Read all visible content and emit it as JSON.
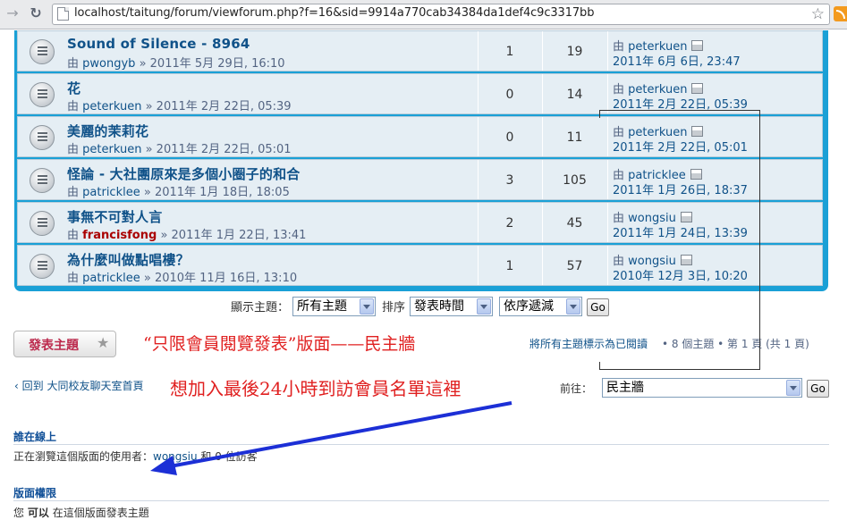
{
  "browser": {
    "url": "localhost/taitung/forum/viewforum.php?f=16&sid=9914a770cab34384da1def4c9c3317bb"
  },
  "topics": [
    {
      "title": "Sound of Silence - 8964",
      "by": "由",
      "author": "pwongyb",
      "author_style": "normal",
      "date": "» 2011年 5月 29日, 16:10",
      "replies": "1",
      "views": "19",
      "last_by": "由",
      "last_author": "peterkuen",
      "last_date": "2011年 6月 6日, 23:47"
    },
    {
      "title": "花",
      "by": "由",
      "author": "peterkuen",
      "author_style": "normal",
      "date": "» 2011年 2月 22日, 05:39",
      "replies": "0",
      "views": "14",
      "last_by": "由",
      "last_author": "peterkuen",
      "last_date": "2011年 2月 22日, 05:39"
    },
    {
      "title": "美麗的茉莉花",
      "by": "由",
      "author": "peterkuen",
      "author_style": "normal",
      "date": "» 2011年 2月 22日, 05:01",
      "replies": "0",
      "views": "11",
      "last_by": "由",
      "last_author": "peterkuen",
      "last_date": "2011年 2月 22日, 05:01"
    },
    {
      "title": "怪論 - 大社團原來是多個小圈子的和合",
      "by": "由",
      "author": "patricklee",
      "author_style": "normal",
      "date": "» 2011年 1月 18日, 18:05",
      "replies": "3",
      "views": "105",
      "last_by": "由",
      "last_author": "patricklee",
      "last_date": "2011年 1月 26日, 18:37"
    },
    {
      "title": "事無不可對人言",
      "by": "由",
      "author": "francisfong",
      "author_style": "red",
      "date": "» 2011年 1月 22日, 13:41",
      "replies": "2",
      "views": "45",
      "last_by": "由",
      "last_author": "wongsiu",
      "last_date": "2011年 1月 24日, 13:39"
    },
    {
      "title": "為什麼叫做點唱樓？",
      "by": "由",
      "author": "patricklee",
      "author_style": "normal",
      "date": "» 2010年 11月 16日, 13:10",
      "replies": "1",
      "views": "57",
      "last_by": "由",
      "last_author": "wongsiu",
      "last_date": "2010年 12月 3日, 10:20"
    }
  ],
  "filter": {
    "display_label": "顯示主題：",
    "display_value": "所有主題",
    "sort_label": "排序",
    "sort_value": "發表時間",
    "order_value": "依序遞減",
    "go_label": "Go"
  },
  "post_button": {
    "label": "發表主題",
    "icon": "star-icon"
  },
  "annotations": {
    "line1": "“只限會員閱覽發表”版面——民主牆",
    "line2": "想加入最後24小時到訪會員名單這裡",
    "color": "#e02020"
  },
  "pagination": {
    "mark_read": "將所有主題標示為已閱讀",
    "info": "• 8 個主題 • 第 1 頁 (共 1 頁)"
  },
  "back_link": {
    "arrow": "‹",
    "label": "回到 大同校友聊天室首頁"
  },
  "jump": {
    "label": "前往：",
    "value": "民主牆",
    "go_label": "Go"
  },
  "online": {
    "heading": "誰在線上",
    "text_prefix": "正在瀏覽這個版面的使用者：",
    "user": "wongsiu",
    "text_suffix": " 和 0 位訪客"
  },
  "permissions": {
    "heading": "版面權限",
    "prefix": "您",
    "can": "可以",
    "suffix": "在這個版面發表主題"
  },
  "colors": {
    "panel": "#1aa0d6",
    "link": "#105289",
    "arrow": "#1c2fd6"
  }
}
